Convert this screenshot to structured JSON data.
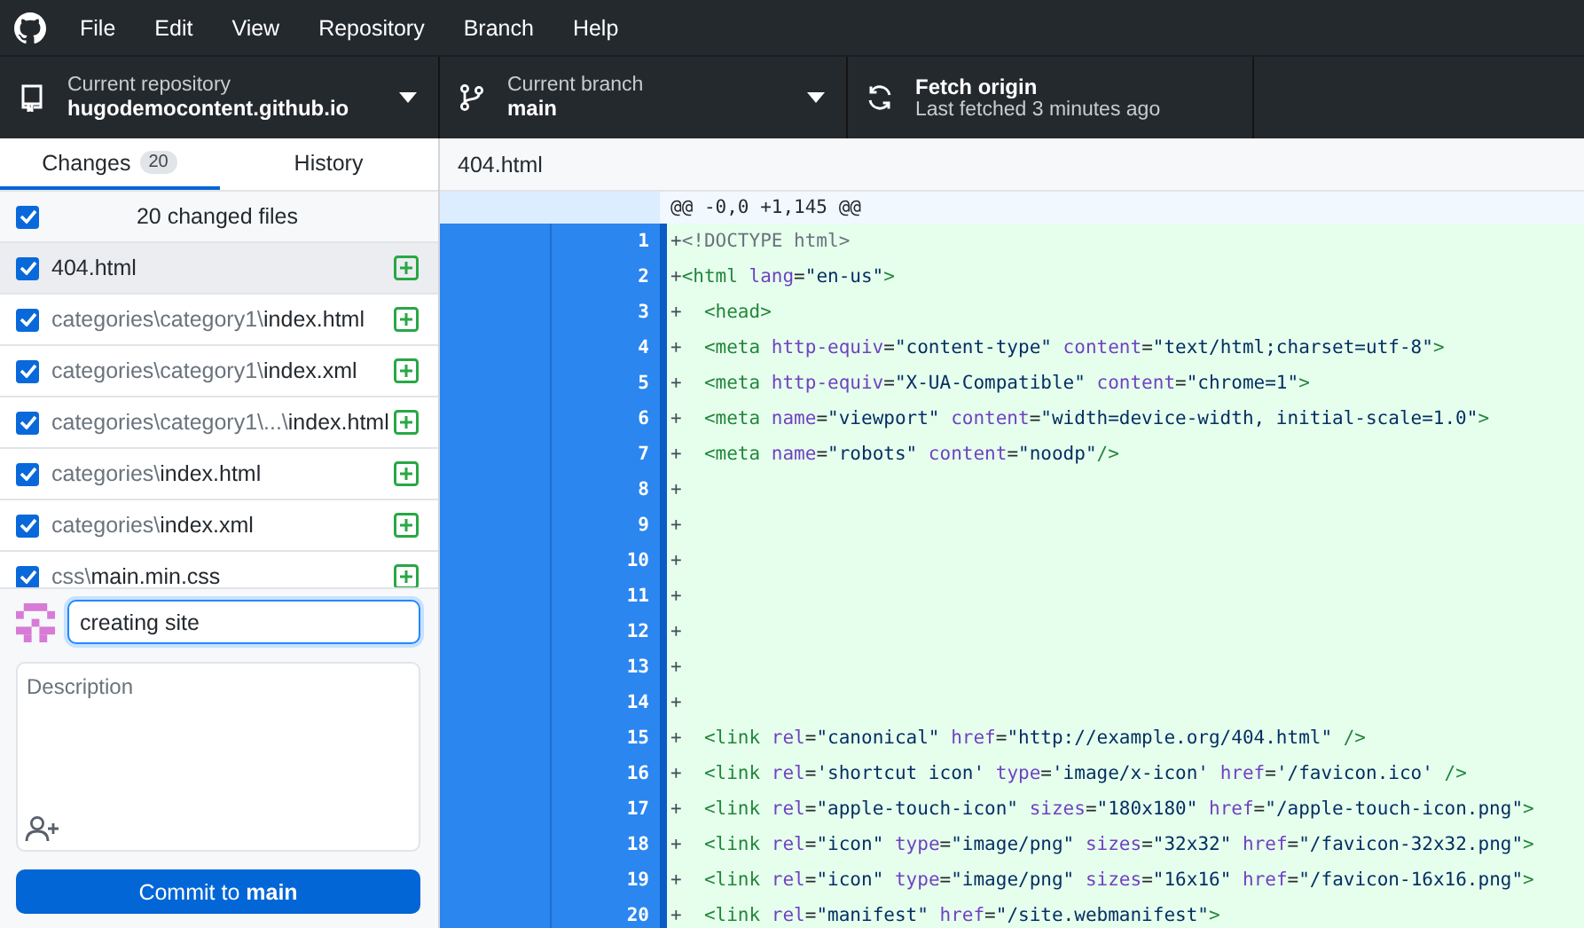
{
  "menu": [
    {
      "label": "File"
    },
    {
      "label": "Edit"
    },
    {
      "label": "View"
    },
    {
      "label": "Repository"
    },
    {
      "label": "Branch"
    },
    {
      "label": "Help"
    }
  ],
  "toolbar": {
    "repository": {
      "label": "Current repository",
      "value": "hugodemocontent.github.io"
    },
    "branch": {
      "label": "Current branch",
      "value": "main"
    },
    "fetch": {
      "title": "Fetch origin",
      "subtitle": "Last fetched 3 minutes ago"
    }
  },
  "tabs": [
    {
      "label": "Changes",
      "count": "20",
      "selected": true
    },
    {
      "label": "History",
      "selected": false
    }
  ],
  "file_header": "404.html",
  "changes": {
    "all_checked": true,
    "summary": "20 changed files",
    "files": [
      {
        "name": "404.html",
        "checked": true,
        "selected": true
      },
      {
        "dir": "categories\\category1\\",
        "name": "index.html",
        "checked": true,
        "selected": false
      },
      {
        "dir": "categories\\category1\\",
        "name": "index.xml",
        "checked": true,
        "selected": false
      },
      {
        "dir": "categories\\category1\\...\\",
        "name": "index.html",
        "checked": true,
        "selected": false
      },
      {
        "dir": "categories\\",
        "name": "index.html",
        "checked": true,
        "selected": false
      },
      {
        "dir": "categories\\",
        "name": "index.xml",
        "checked": true,
        "selected": false
      },
      {
        "dir": "css\\",
        "name": "main.min.css",
        "checked": true,
        "selected": false
      }
    ]
  },
  "commit": {
    "summary": "creating site",
    "description": {
      "placeholder": "Description"
    },
    "button": "Commit to **main**"
  },
  "diff": {
    "hunk": "@@ -0,0 +1,145 @@",
    "lines": [
      {
        "number": "1",
        "tokens": [
          {
            "kind": "plus",
            "text": "+"
          },
          {
            "kind": "doctype",
            "text": "<!DOCTYPE html>"
          }
        ]
      },
      {
        "number": "2",
        "tokens": [
          {
            "kind": "plus",
            "text": "+"
          },
          {
            "kind": "tag",
            "text": "<html"
          },
          {
            "kind": "attr",
            "text": " lang"
          },
          {
            "kind": "punct",
            "text": "="
          },
          {
            "kind": "str",
            "text": "\"en-us\""
          },
          {
            "kind": "tag",
            "text": ">"
          }
        ]
      },
      {
        "number": "3",
        "tokens": [
          {
            "kind": "plus",
            "text": "+"
          },
          {
            "kind": "tag",
            "text": "  <head>"
          }
        ]
      },
      {
        "number": "4",
        "tokens": [
          {
            "kind": "plus",
            "text": "+"
          },
          {
            "kind": "tag",
            "text": "  <meta"
          },
          {
            "kind": "attr",
            "text": " http-equiv"
          },
          {
            "kind": "punct",
            "text": "="
          },
          {
            "kind": "str",
            "text": "\"content-type\""
          },
          {
            "kind": "attr",
            "text": " content"
          },
          {
            "kind": "punct",
            "text": "="
          },
          {
            "kind": "str",
            "text": "\"text/html;charset=utf-8\""
          },
          {
            "kind": "tag",
            "text": ">"
          }
        ]
      },
      {
        "number": "5",
        "tokens": [
          {
            "kind": "plus",
            "text": "+"
          },
          {
            "kind": "tag",
            "text": "  <meta"
          },
          {
            "kind": "attr",
            "text": " http-equiv"
          },
          {
            "kind": "punct",
            "text": "="
          },
          {
            "kind": "str",
            "text": "\"X-UA-Compatible\""
          },
          {
            "kind": "attr",
            "text": " content"
          },
          {
            "kind": "punct",
            "text": "="
          },
          {
            "kind": "str",
            "text": "\"chrome=1\""
          },
          {
            "kind": "tag",
            "text": ">"
          }
        ]
      },
      {
        "number": "6",
        "tokens": [
          {
            "kind": "plus",
            "text": "+"
          },
          {
            "kind": "tag",
            "text": "  <meta"
          },
          {
            "kind": "attr",
            "text": " name"
          },
          {
            "kind": "punct",
            "text": "="
          },
          {
            "kind": "str",
            "text": "\"viewport\""
          },
          {
            "kind": "attr",
            "text": " content"
          },
          {
            "kind": "punct",
            "text": "="
          },
          {
            "kind": "str",
            "text": "\"width=device-width, initial-scale=1.0\""
          },
          {
            "kind": "tag",
            "text": ">"
          }
        ]
      },
      {
        "number": "7",
        "tokens": [
          {
            "kind": "plus",
            "text": "+"
          },
          {
            "kind": "tag",
            "text": "  <meta"
          },
          {
            "kind": "attr",
            "text": " name"
          },
          {
            "kind": "punct",
            "text": "="
          },
          {
            "kind": "str",
            "text": "\"robots\""
          },
          {
            "kind": "attr",
            "text": " content"
          },
          {
            "kind": "punct",
            "text": "="
          },
          {
            "kind": "str",
            "text": "\"noodp\""
          },
          {
            "kind": "tag",
            "text": "/>"
          }
        ]
      },
      {
        "number": "8",
        "tokens": [
          {
            "kind": "plus",
            "text": "+"
          }
        ]
      },
      {
        "number": "9",
        "tokens": [
          {
            "kind": "plus",
            "text": "+"
          }
        ]
      },
      {
        "number": "10",
        "tokens": [
          {
            "kind": "plus",
            "text": "+"
          }
        ]
      },
      {
        "number": "11",
        "tokens": [
          {
            "kind": "plus",
            "text": "+"
          }
        ]
      },
      {
        "number": "12",
        "tokens": [
          {
            "kind": "plus",
            "text": "+"
          }
        ]
      },
      {
        "number": "13",
        "tokens": [
          {
            "kind": "plus",
            "text": "+"
          }
        ]
      },
      {
        "number": "14",
        "tokens": [
          {
            "kind": "plus",
            "text": "+"
          }
        ]
      },
      {
        "number": "15",
        "tokens": [
          {
            "kind": "plus",
            "text": "+"
          },
          {
            "kind": "tag",
            "text": "  <link"
          },
          {
            "kind": "attr",
            "text": " rel"
          },
          {
            "kind": "punct",
            "text": "="
          },
          {
            "kind": "str",
            "text": "\"canonical\""
          },
          {
            "kind": "attr",
            "text": " href"
          },
          {
            "kind": "punct",
            "text": "="
          },
          {
            "kind": "str",
            "text": "\"http://example.org/404.html\""
          },
          {
            "kind": "tag",
            "text": " />"
          }
        ]
      },
      {
        "number": "16",
        "tokens": [
          {
            "kind": "plus",
            "text": "+"
          },
          {
            "kind": "tag",
            "text": "  <link"
          },
          {
            "kind": "attr",
            "text": " rel"
          },
          {
            "kind": "punct",
            "text": "="
          },
          {
            "kind": "str",
            "text": "'shortcut icon'"
          },
          {
            "kind": "attr",
            "text": " type"
          },
          {
            "kind": "punct",
            "text": "="
          },
          {
            "kind": "str",
            "text": "'image/x-icon'"
          },
          {
            "kind": "attr",
            "text": " href"
          },
          {
            "kind": "punct",
            "text": "="
          },
          {
            "kind": "str",
            "text": "'/favicon.ico'"
          },
          {
            "kind": "tag",
            "text": " />"
          }
        ]
      },
      {
        "number": "17",
        "tokens": [
          {
            "kind": "plus",
            "text": "+"
          },
          {
            "kind": "tag",
            "text": "  <link"
          },
          {
            "kind": "attr",
            "text": " rel"
          },
          {
            "kind": "punct",
            "text": "="
          },
          {
            "kind": "str",
            "text": "\"apple-touch-icon\""
          },
          {
            "kind": "attr",
            "text": " sizes"
          },
          {
            "kind": "punct",
            "text": "="
          },
          {
            "kind": "str",
            "text": "\"180x180\""
          },
          {
            "kind": "attr",
            "text": " href"
          },
          {
            "kind": "punct",
            "text": "="
          },
          {
            "kind": "str",
            "text": "\"/apple-touch-icon.png\""
          },
          {
            "kind": "tag",
            "text": ">"
          }
        ]
      },
      {
        "number": "18",
        "tokens": [
          {
            "kind": "plus",
            "text": "+"
          },
          {
            "kind": "tag",
            "text": "  <link"
          },
          {
            "kind": "attr",
            "text": " rel"
          },
          {
            "kind": "punct",
            "text": "="
          },
          {
            "kind": "str",
            "text": "\"icon\""
          },
          {
            "kind": "attr",
            "text": " type"
          },
          {
            "kind": "punct",
            "text": "="
          },
          {
            "kind": "str",
            "text": "\"image/png\""
          },
          {
            "kind": "attr",
            "text": " sizes"
          },
          {
            "kind": "punct",
            "text": "="
          },
          {
            "kind": "str",
            "text": "\"32x32\""
          },
          {
            "kind": "attr",
            "text": " href"
          },
          {
            "kind": "punct",
            "text": "="
          },
          {
            "kind": "str",
            "text": "\"/favicon-32x32.png\""
          },
          {
            "kind": "tag",
            "text": ">"
          }
        ]
      },
      {
        "number": "19",
        "tokens": [
          {
            "kind": "plus",
            "text": "+"
          },
          {
            "kind": "tag",
            "text": "  <link"
          },
          {
            "kind": "attr",
            "text": " rel"
          },
          {
            "kind": "punct",
            "text": "="
          },
          {
            "kind": "str",
            "text": "\"icon\""
          },
          {
            "kind": "attr",
            "text": " type"
          },
          {
            "kind": "punct",
            "text": "="
          },
          {
            "kind": "str",
            "text": "\"image/png\""
          },
          {
            "kind": "attr",
            "text": " sizes"
          },
          {
            "kind": "punct",
            "text": "="
          },
          {
            "kind": "str",
            "text": "\"16x16\""
          },
          {
            "kind": "attr",
            "text": " href"
          },
          {
            "kind": "punct",
            "text": "="
          },
          {
            "kind": "str",
            "text": "\"/favicon-16x16.png\""
          },
          {
            "kind": "tag",
            "text": ">"
          }
        ]
      },
      {
        "number": "20",
        "tokens": [
          {
            "kind": "plus",
            "text": "+"
          },
          {
            "kind": "tag",
            "text": "  <link"
          },
          {
            "kind": "attr",
            "text": " rel"
          },
          {
            "kind": "punct",
            "text": "="
          },
          {
            "kind": "str",
            "text": "\"manifest\""
          },
          {
            "kind": "attr",
            "text": " href"
          },
          {
            "kind": "punct",
            "text": "="
          },
          {
            "kind": "str",
            "text": "\"/site.webmanifest\""
          },
          {
            "kind": "tag",
            "text": ">"
          }
        ]
      }
    ]
  }
}
